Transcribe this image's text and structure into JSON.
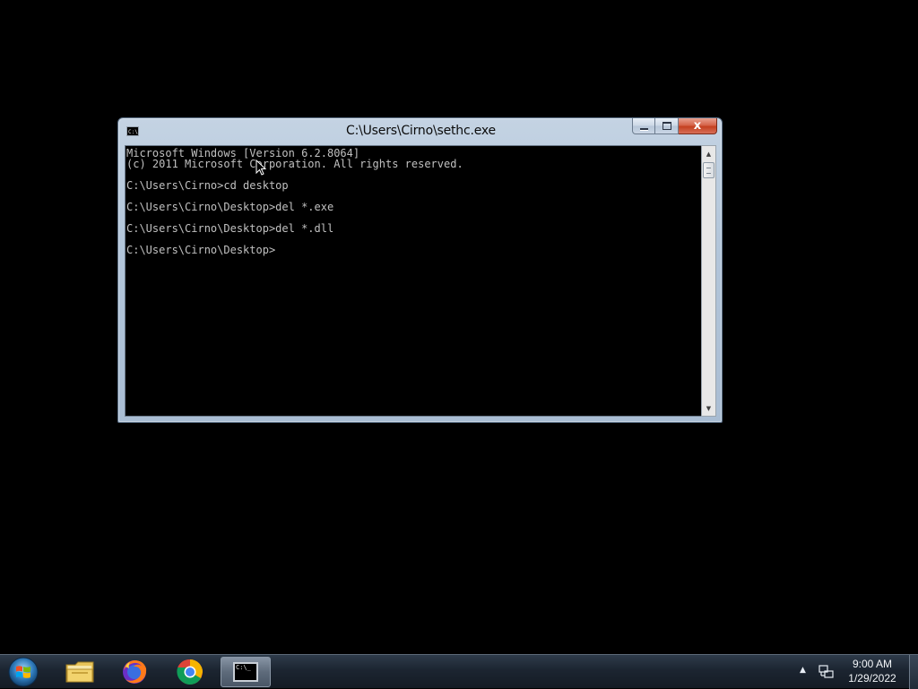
{
  "window": {
    "title": "C:\\Users\\Cirno\\sethc.exe",
    "icon_text": "C:\\.",
    "close_glyph": "x"
  },
  "console": {
    "lines": [
      "Microsoft Windows [Version 6.2.8064]",
      "(c) 2011 Microsoft Corporation. All rights reserved.",
      "",
      "C:\\Users\\Cirno>cd desktop",
      "",
      "C:\\Users\\Cirno\\Desktop>del *.exe",
      "",
      "C:\\Users\\Cirno\\Desktop>del *.dll",
      "",
      "C:\\Users\\Cirno\\Desktop>"
    ]
  },
  "taskbar": {
    "items": [
      {
        "name": "windows-explorer",
        "icon": "folder-icon"
      },
      {
        "name": "firefox",
        "icon": "firefox-icon"
      },
      {
        "name": "chrome",
        "icon": "chrome-icon"
      },
      {
        "name": "command-prompt",
        "icon": "cmd-icon",
        "active": true
      }
    ],
    "cmd_icon_text": "C:\\_",
    "clock": {
      "time": "9:00 AM",
      "date": "1/29/2022"
    }
  },
  "colors": {
    "console_bg": "#000000",
    "console_fg": "#c0c0c0",
    "close_button": "#c4401f",
    "window_frame": "#b3c6da"
  }
}
